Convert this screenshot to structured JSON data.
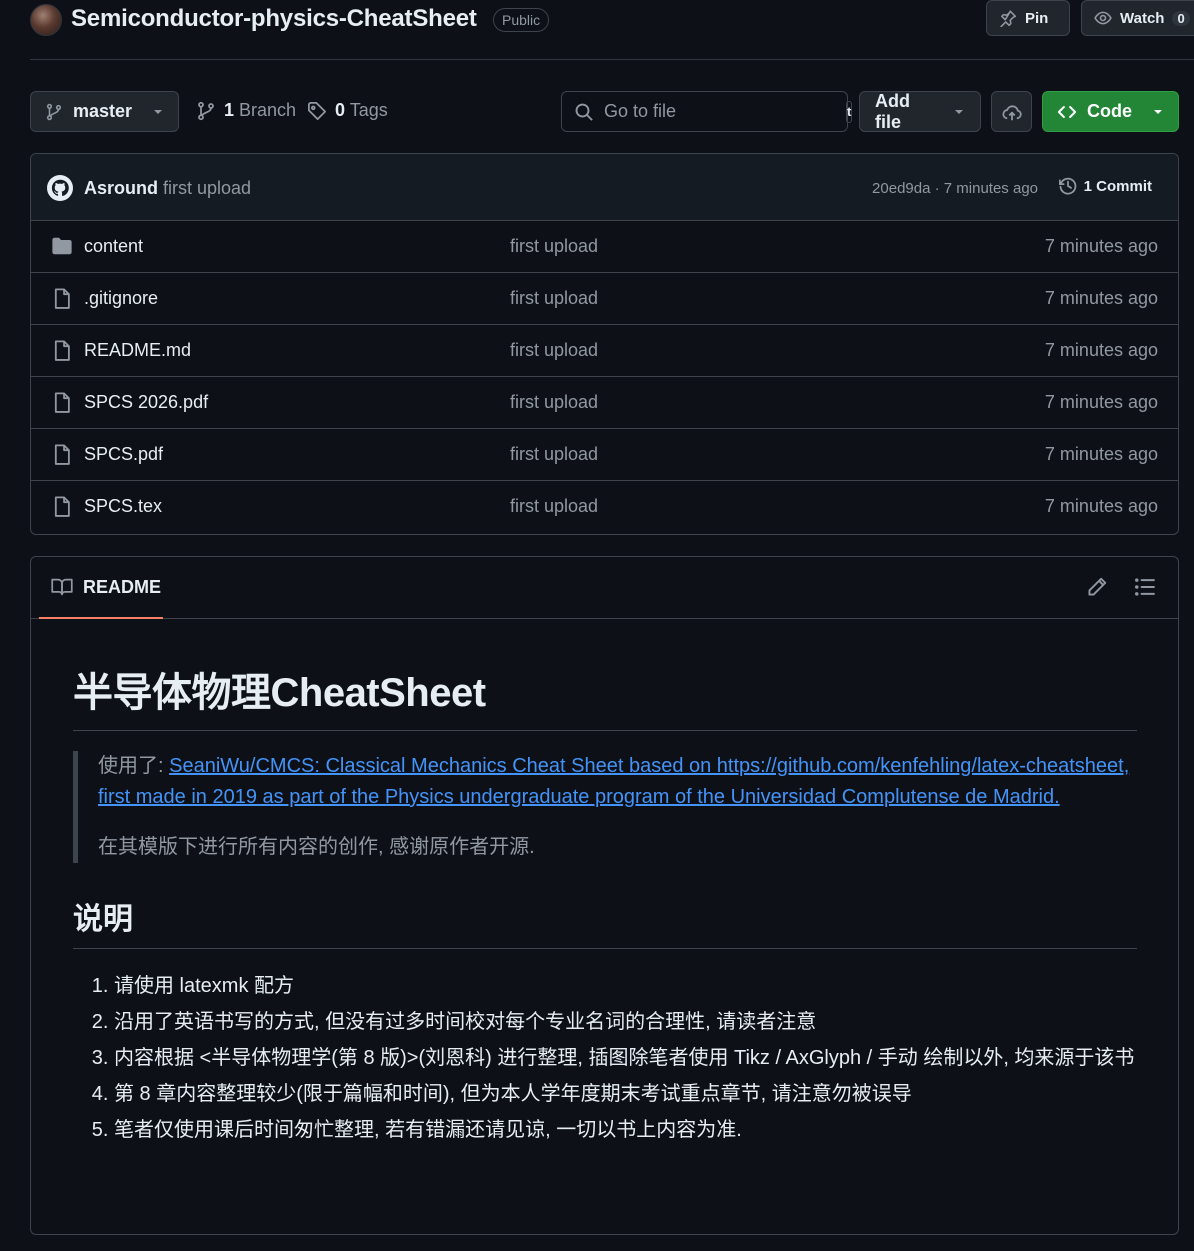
{
  "repo": {
    "name": "Semiconductor-physics-CheatSheet",
    "visibility": "Public",
    "pin_label": "Pin",
    "watch_label": "Watch",
    "watch_count": "0"
  },
  "toolbar": {
    "branch": "master",
    "branch_count": "1",
    "branch_label": "Branch",
    "tag_count": "0",
    "tag_label": "Tags",
    "go_to_file_placeholder": "Go to file",
    "go_to_file_shortcut": "t",
    "add_file_label": "Add file",
    "code_label": "Code"
  },
  "commit": {
    "author": "Asround",
    "message": "first upload",
    "hash_time": "20ed9da · 7 minutes ago",
    "count_label": "1 Commit"
  },
  "files": [
    {
      "name": "content",
      "type": "folder",
      "message": "first upload",
      "age": "7 minutes ago"
    },
    {
      "name": ".gitignore",
      "type": "file",
      "message": "first upload",
      "age": "7 minutes ago"
    },
    {
      "name": "README.md",
      "type": "file",
      "message": "first upload",
      "age": "7 minutes ago"
    },
    {
      "name": "SPCS 2026.pdf",
      "type": "file",
      "message": "first upload",
      "age": "7 minutes ago"
    },
    {
      "name": "SPCS.pdf",
      "type": "file",
      "message": "first upload",
      "age": "7 minutes ago"
    },
    {
      "name": "SPCS.tex",
      "type": "file",
      "message": "first upload",
      "age": "7 minutes ago"
    }
  ],
  "readme": {
    "tab_label": "README",
    "title": "半导体物理CheatSheet",
    "quote_prefix": "使用了: ",
    "quote_link": "SeaniWu/CMCS: Classical Mechanics Cheat Sheet based on https://github.com/kenfehling/latex-cheatsheet, first made in 2019 as part of the Physics undergraduate program of the Universidad Complutense de Madrid.",
    "quote_note": "在其模版下进行所有内容的创作, 感谢原作者开源.",
    "section_title": "说明",
    "items": [
      "请使用 latexmk 配方",
      "沿用了英语书写的方式, 但没有过多时间校对每个专业名词的合理性, 请读者注意",
      "内容根据 <半导体物理学(第 8 版)>(刘恩科) 进行整理, 插图除笔者使用 Tikz / AxGlyph / 手动 绘制以外, 均来源于该书",
      "第 8 章内容整理较少(限于篇幅和时间), 但为本人学年度期末考试重点章节, 请注意勿被误导",
      "笔者仅使用课后时间匆忙整理, 若有错漏还请见谅, 一切以书上内容为准."
    ]
  },
  "colors": {
    "background": "#0d1117",
    "border": "#3d444d",
    "accent_green": "#238636",
    "link_blue": "#4493f8",
    "tab_underline": "#f78166"
  }
}
